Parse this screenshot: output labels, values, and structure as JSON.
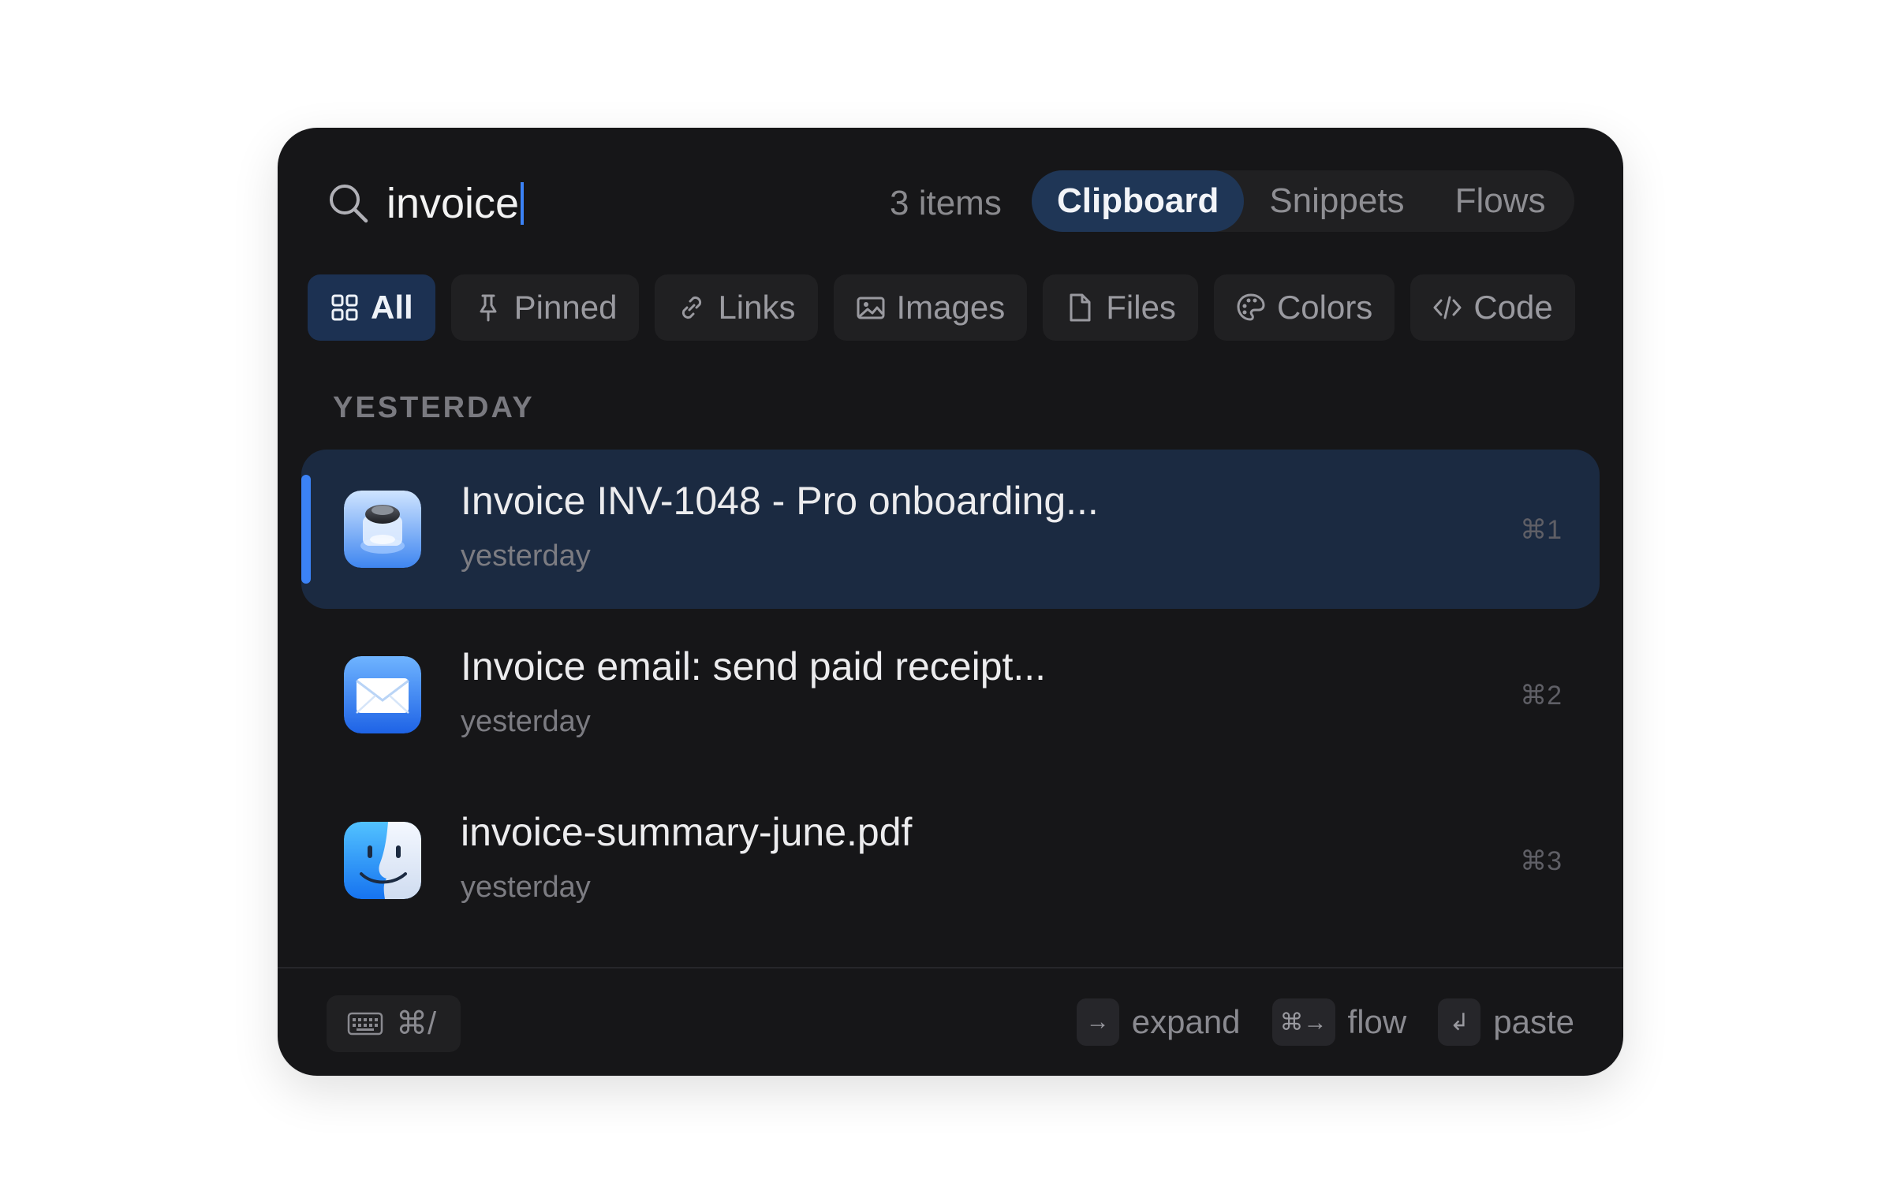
{
  "search": {
    "query": "invoice",
    "item_count": "3 items"
  },
  "mode_tabs": [
    {
      "label": "Clipboard",
      "active": true
    },
    {
      "label": "Snippets",
      "active": false
    },
    {
      "label": "Flows",
      "active": false
    }
  ],
  "filters": [
    {
      "label": "All",
      "icon": "grid-icon",
      "active": true
    },
    {
      "label": "Pinned",
      "icon": "pin-icon",
      "active": false
    },
    {
      "label": "Links",
      "icon": "link-icon",
      "active": false
    },
    {
      "label": "Images",
      "icon": "image-icon",
      "active": false
    },
    {
      "label": "Files",
      "icon": "file-icon",
      "active": false
    },
    {
      "label": "Colors",
      "icon": "palette-icon",
      "active": false
    },
    {
      "label": "Code",
      "icon": "code-icon",
      "active": false
    }
  ],
  "section": {
    "label": "YESTERDAY"
  },
  "items": [
    {
      "title": "Invoice INV-1048 - Pro onboarding...",
      "subtitle": "yesterday",
      "shortcut": "⌘1",
      "app_icon": "preview-app-icon",
      "selected": true
    },
    {
      "title": "Invoice email: send paid receipt...",
      "subtitle": "yesterday",
      "shortcut": "⌘2",
      "app_icon": "mail-app-icon",
      "selected": false
    },
    {
      "title": "invoice-summary-june.pdf",
      "subtitle": "yesterday",
      "shortcut": "⌘3",
      "app_icon": "finder-app-icon",
      "selected": false
    }
  ],
  "footer": {
    "keyboard_shortcut": "⌘/",
    "hints": [
      {
        "key": "→",
        "label": "expand"
      },
      {
        "key": "⌘→",
        "label": "flow"
      },
      {
        "key": "↲",
        "label": "paste"
      }
    ]
  },
  "colors": {
    "accent": "#3b82f6",
    "panel": "#161618",
    "selected_row": "#1b2a41",
    "active_tab": "#1f3656"
  }
}
